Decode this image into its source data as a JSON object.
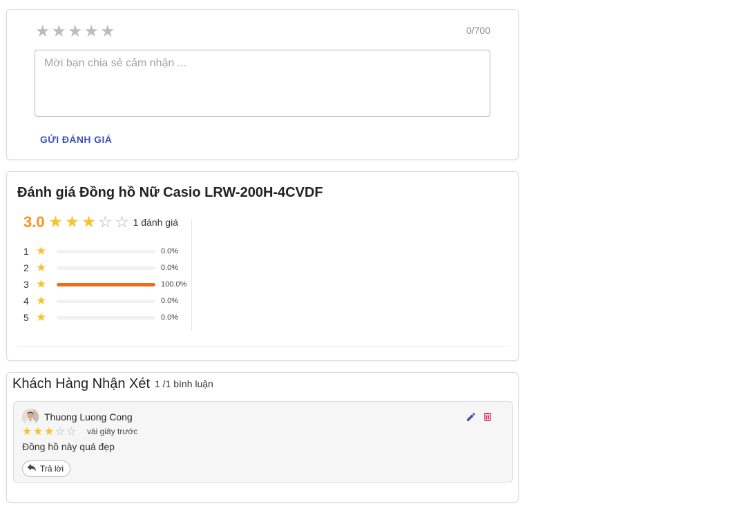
{
  "review_form": {
    "stars_total": 5,
    "char_count": "0/700",
    "placeholder": "Mời bạn chia sẻ cảm nhận ...",
    "value": "",
    "submit_label": "GỬI ĐÁNH GIÁ",
    "star_icon": "star-outline-icon",
    "star_color": "#bdbdbd"
  },
  "summary": {
    "title": "Đánh giá Đồng hồ Nữ Casio LRW-200H-4CVDF",
    "average": "3.0",
    "average_value": 3,
    "review_count": "1 đánh giá",
    "accent_color": "#f7941d",
    "star_color": "#fbc02d",
    "bar_color": "#ef6c1a",
    "distribution": [
      {
        "level": "1",
        "percent": "0.0%",
        "fraction": 0
      },
      {
        "level": "2",
        "percent": "0.0%",
        "fraction": 0
      },
      {
        "level": "3",
        "percent": "100.0%",
        "fraction": 1
      },
      {
        "level": "4",
        "percent": "0.0%",
        "fraction": 0
      },
      {
        "level": "5",
        "percent": "0.0%",
        "fraction": 0
      }
    ]
  },
  "comments": {
    "title": "Khách Hàng Nhận Xét",
    "count": "1 /1 bình luận",
    "items": [
      {
        "author": "Thuong Luong Cong",
        "rating": 3,
        "time": "vài giây trước",
        "text": "Đồng hồ này quá đẹp",
        "reply_label": "Trả lời",
        "edit_icon": "edit-pencil-icon",
        "delete_icon": "trash-icon",
        "edit_color": "#3f51b5",
        "delete_color": "#e91e63"
      }
    ]
  }
}
